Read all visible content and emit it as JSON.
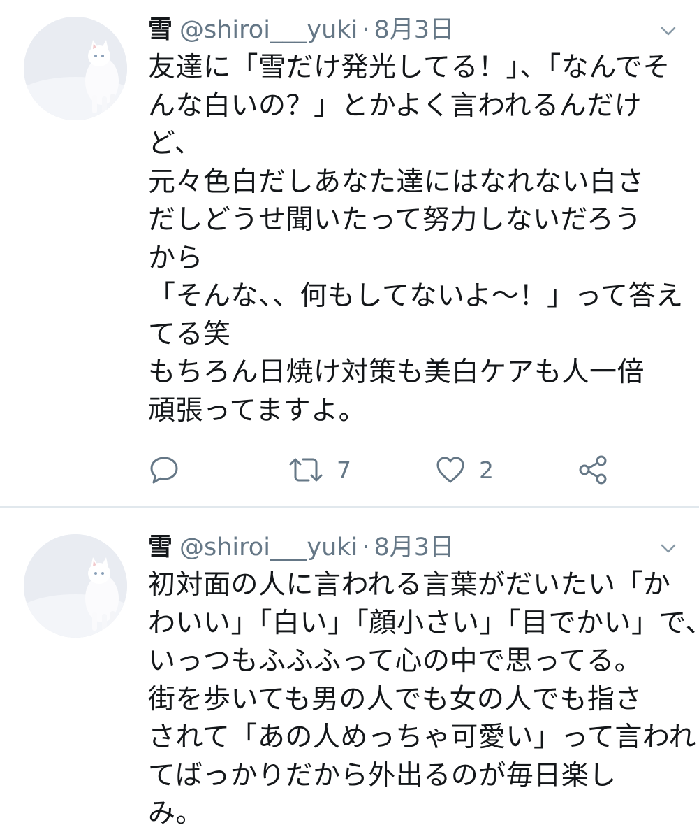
{
  "colors": {
    "text_primary": "#14171a",
    "text_secondary": "#657786",
    "divider": "#e1e8ed",
    "background": "#ffffff"
  },
  "tweets": [
    {
      "display_name": "雪",
      "handle": "@shiroi___yuki",
      "separator": "·",
      "date": "8月3日",
      "avatar_icon": "white-cat-avatar",
      "lines": [
        "友達に「雪だけ発光してる！」、「なんでそ",
        "んな白いの？」とかよく言われるんだけ",
        "ど、",
        "元々色白だしあなた達にはなれない白さ",
        "だしどうせ聞いたって努力しないだろう",
        "から",
        "「そんな、、何もしてないよ〜！」って答え",
        "てる笑",
        "もちろん日焼け対策も美白ケアも人一倍",
        "頑張ってますよ。"
      ],
      "actions": {
        "reply_icon": "reply-icon",
        "retweet_icon": "retweet-icon",
        "retweet_count": "7",
        "like_icon": "heart-icon",
        "like_count": "2",
        "share_icon": "share-icon"
      }
    },
    {
      "display_name": "雪",
      "handle": "@shiroi___yuki",
      "separator": "·",
      "date": "8月3日",
      "avatar_icon": "white-cat-avatar",
      "lines": [
        "初対面の人に言われる言葉がだいたい「か",
        "わいい」「白い」「顔小さい」「目でかい」で、",
        "いっつもふふふって心の中で思ってる。",
        "街を歩いても男の人でも女の人でも指さ",
        "されて「あの人めっちゃ可愛い」って言われ",
        "てばっかりだから外出るのが毎日楽し",
        "み。"
      ]
    }
  ]
}
